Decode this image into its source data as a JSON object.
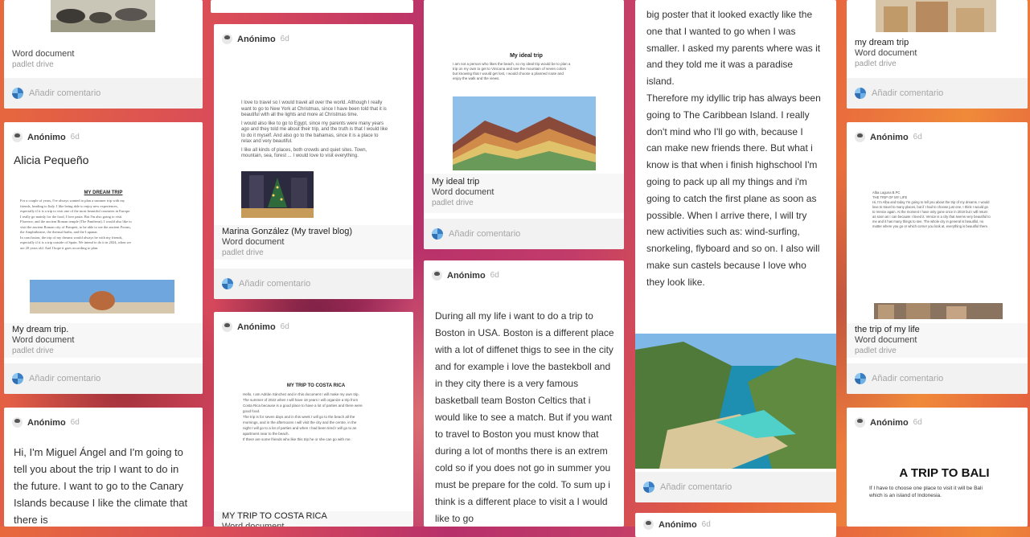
{
  "comment_label": "Añadir comentario",
  "col1": {
    "card_top": {
      "title": "Word document",
      "source": "padlet drive"
    },
    "card_mid": {
      "author": "Anónimo",
      "time": "6d",
      "heading": "Alicia Pequeño",
      "doc_title": "MY DREAM TRIP",
      "doc_lines": [
        "For a couple of years, I've always wanted to plan a summer trip with my",
        "friends, heading to Italy. I like being able to enjoy new experiences,",
        "especially if it is a trip to visit one of the most beautiful countries in Europe.",
        "I really go mainly for the food, I love pasta. But I'm also going to visit",
        "Florence, and the ancient Roman temple (The Pantheon). I would also like to",
        "visit the ancient Roman city of Pompeii, to be able to see the ancient Forum,",
        "the Amphitheatre, the thermal baths, and the Lupanar.",
        "In conclusion, the trip of my dreams would always be with my friends,",
        "especially if it is a trip outside of Spain. We intend to do it in 2024, when we",
        "are 20 years old. And I hope it goes according to plan."
      ],
      "title": "My dream trip.",
      "type": "Word document",
      "source": "padlet drive"
    },
    "card_bottom": {
      "author": "Anónimo",
      "time": "6d",
      "text": "Hi, I'm Miguel Ángel and I'm going to tell you about the trip I want to do in the future. I want to go to the Canary Islands because I like the climate that there is"
    }
  },
  "col2": {
    "card_a": {
      "author": "Anónimo",
      "time": "6d",
      "doc_paragraphs": [
        "I love to travel so I would travel all over the world. Although I really want to go to New York at Christmas, since I have been told that it is beautiful with all the lights and more at Christmas time.",
        "I would also like to go to Egypt, since my parents were many years ago and they told me about their trip, and the truth is that I would like to do it myself. And also go to the bahamas, since it is a place to relax and very beautiful.",
        "I like all kinds of places, both crowds and quiet sites. Town, mountain, sea, forest ... I would love to visit everything."
      ],
      "title": "Marina González (My travel blog)",
      "type": "Word document",
      "source": "padlet drive"
    },
    "card_b": {
      "author": "Anónimo",
      "time": "6d",
      "doc_title": "MY TRIP TO COSTA RICA",
      "doc_lines": [
        "Hello, I am Adrián Sánchez and in this document I will make my own trip.",
        "The summer of 2022 when I will have 18 years I will organize a trip from",
        "Costa Rica because is a good place to have a lot of parties and there were",
        "good food.",
        "The trip is for seven days and in this week I will go to the beach all the",
        "mornings, and in the afternoons I will visit the city and the centre, in the",
        "night I will go to a lot of parties and when I had been tired I will go to an",
        "apartment near to the beach.",
        "If there are some friends who like this trip he or she can go with me."
      ],
      "title": "MY TRIP TO COSTA RICA",
      "type": "Word document"
    }
  },
  "col3": {
    "card_a": {
      "doc_title": "My ideal trip",
      "doc_lines": [
        "I am not a person who likes the beach, so my ideal trip would be to plan a",
        "trip on my own to get to Vinicuna and see the mountain of seven colors",
        "but knowing that I would get lost, I would choose a planned route and",
        "enjoy the walk and the views."
      ],
      "title": "My ideal trip",
      "type": "Word document",
      "source": "padlet drive"
    },
    "card_b": {
      "author": "Anónimo",
      "time": "6d",
      "text": "During all my life i want to do a trip to Boston in USA. Boston is a different place with a lot of diffenet thigs to see in the city and for example i love the bastekboll and in they city there is a very famous basketball team Boston Celtics that i would like to see a match. But if you want to travel to Boston you must know that during a lot of months there is an extrem cold so if you does not go in summer you must be prepare for the cold. To sum up i think is a different place to visit a I would like to go"
    }
  },
  "col4": {
    "card_a": {
      "text_lines": [
        "big poster that it looked exactly like the",
        "one that I wanted to go when I was",
        "smaller. I asked my parents where was it",
        "and they told me it was a paradise",
        "island.",
        "Therefore my idyllic trip has always been",
        "going to The Caribbean Island. I really",
        "don't mind who I'll go with, because I",
        "can make new friends there. But what i",
        "know is that when i finish highschool I'm",
        "going to pack up all my things and i'm",
        "going to catch the first plane as soon as",
        "possible. When I arrive there, I will try",
        "new activities such as: wind-surfing,",
        "snorkeling, flyboard and so on. I also will",
        "make sun castels because I love who",
        "they look like."
      ]
    },
    "card_b": {
      "author": "Anónimo",
      "time": "6d"
    }
  },
  "col5": {
    "card_a": {
      "title": "my dream trip",
      "type": "Word document",
      "source": "padlet drive"
    },
    "card_b": {
      "author": "Anónimo",
      "time": "6d",
      "doc_lines": [
        "Alba Laguna B.PC",
        "THE TRIP OF MY LIFE",
        "Hi, I'm Alba and today I'm going to tell you about the trip of my dreams. I would",
        "love to travel to many places, but if I had to choose just one, I think I would go",
        "to Venice again. At the moment I have only gone once in 2019 but I will return",
        "as soon as I can because I loved it. Venice is a city that seems very beautiful to",
        "me and it has many things to see. The whole city in general is beautiful, no",
        "matter where you go or which corner you look at, everything is beautiful there."
      ],
      "title": "the trip of my life",
      "type": "Word document",
      "source": "padlet drive"
    },
    "card_c": {
      "author": "Anónimo",
      "time": "6d",
      "doc_title": "A TRIP TO BALI",
      "doc_lines": [
        "If I have to choose one place to visit it will be Bali",
        "which is an island of Indonesia."
      ]
    }
  }
}
